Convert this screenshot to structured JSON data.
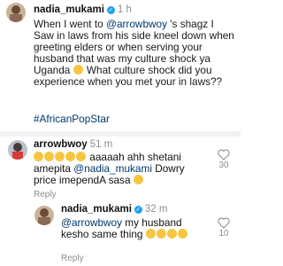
{
  "post": {
    "username": "nadia_mukami",
    "verified_mark": "✓",
    "time": "1 h",
    "body_1": "When I went to ",
    "mention": "@arrowbwoy",
    "body_2": " 's shagz I Saw in laws from his side kneel down when greeting elders or when serving your husband that was my culture shock ya Uganda ",
    "body_3": " What culture shock did you experience when you met your in laws??",
    "hashtag": "#AfricanPopStar",
    "emoji": "smiling-face-emoji"
  },
  "comments": [
    {
      "username": "arrowbwoy",
      "time": "51 m",
      "text_1": "aaaaah ahh shetani amepita ",
      "mention": "@nadia_mukami",
      "text_2": " Dowry price imependA sasa ",
      "likes": "30",
      "reply_label": "Reply",
      "emoji": "laughing-face-emoji"
    },
    {
      "username": "nadia_mukami",
      "verified_mark": "✓",
      "time": "32 m",
      "mention": "@arrowbwoy",
      "text_1": " my husband kesho same thing ",
      "likes": "10",
      "reply_label": "Reply",
      "emoji": "laughing-face-emoji"
    }
  ],
  "icons": {
    "like": "heart-icon"
  },
  "colors": {
    "mention": "#00376b",
    "verified": "#1da1f2",
    "meta": "#8e8e8e",
    "emoji": "#f6c641"
  }
}
